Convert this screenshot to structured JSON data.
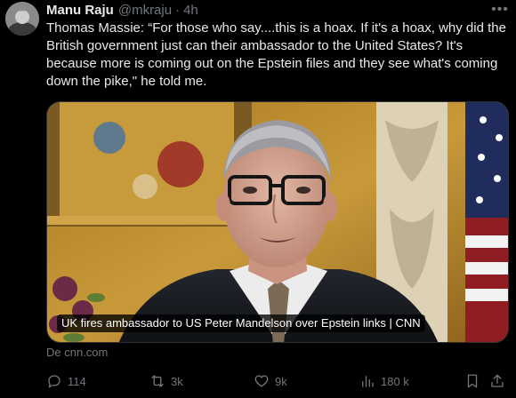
{
  "tweet": {
    "author_name": "Manu Raju",
    "author_handle": "@mkraju",
    "separator": "·",
    "time": "4h",
    "text": "Thomas Massie: “For those who say....this is a hoax. If it's a hoax, why did the British government just can their ambassador to the United States? It's because more is coming out on the Epstein files and they see what's coming down the pike,\" he told me."
  },
  "card": {
    "caption": "UK fires ambassador to US Peter Mandelson over Epstein links | CNN",
    "source": "De cnn.com"
  },
  "actions": {
    "replies": "114",
    "reposts": "3k",
    "likes": "9k",
    "views": "180 k"
  },
  "icons": {
    "more": "more-horizontal-icon",
    "reply": "reply-icon",
    "repost": "repost-icon",
    "like": "heart-icon",
    "views": "views-chart-icon",
    "bookmark": "bookmark-icon",
    "share": "share-icon"
  },
  "colors": {
    "background": "#000000",
    "text": "#e7e9ea",
    "muted": "#71767b",
    "border": "#2f3336"
  }
}
